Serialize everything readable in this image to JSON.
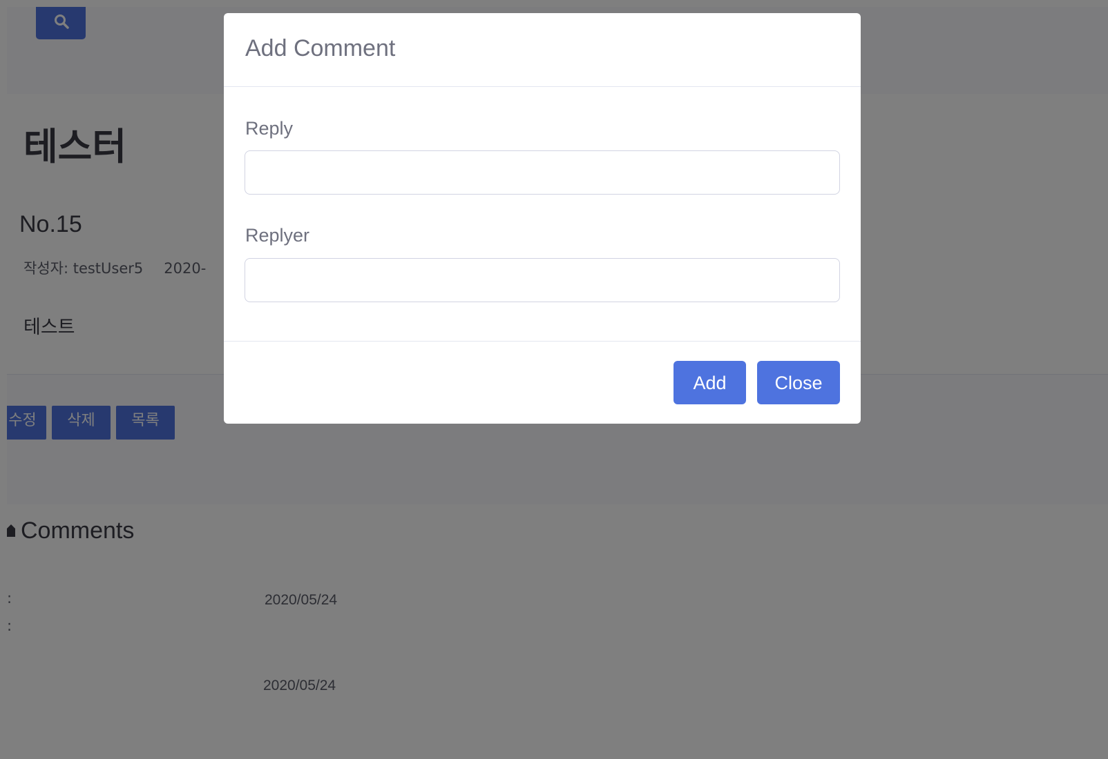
{
  "header": {
    "search_icon": "search-icon"
  },
  "post": {
    "title": "테스터",
    "number": "No.15",
    "author": "작성자: testUser5",
    "date_partial": "2020-",
    "body": "테스트"
  },
  "actions": {
    "edit_label": "수정",
    "delete_label": "삭제",
    "list_label": "목록"
  },
  "comments": {
    "heading": "Comments",
    "items": [
      {
        "date": "2020/05/24"
      },
      {
        "date": "2020/05/24"
      }
    ]
  },
  "modal": {
    "title": "Add Comment",
    "reply_label": "Reply",
    "reply_value": "",
    "replyer_label": "Replyer",
    "replyer_value": "",
    "add_label": "Add",
    "close_label": "Close"
  },
  "colors": {
    "primary": "#4e73df",
    "overlay": "rgba(0,0,0,0.5)",
    "text": "#6e707e"
  }
}
